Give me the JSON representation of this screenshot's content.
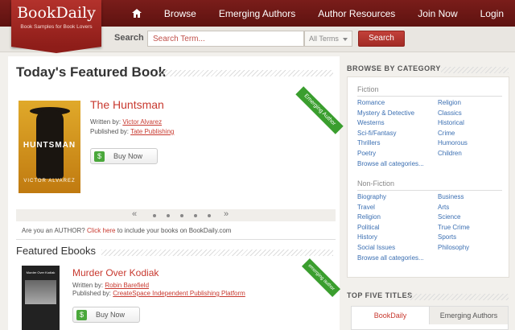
{
  "header": {
    "logo_name": "BookDaily",
    "logo_tagline": "Book Samples for Book Lovers",
    "nav": [
      "Browse",
      "Emerging Authors",
      "Author Resources",
      "Join Now",
      "Login"
    ]
  },
  "search": {
    "label": "Search",
    "placeholder": "Search Term...",
    "filter": "All Terms",
    "button": "Search"
  },
  "featured": {
    "heading": "Today's Featured Book",
    "title": "The Huntsman",
    "cover_title": "HUNTSMAN",
    "cover_author": "VICTOR ALVAREZ",
    "written_by_label": "Written by:",
    "author": "Victor Alvarez",
    "published_by_label": "Published by:",
    "publisher": "Tate Publishing",
    "buy_label": "Buy Now",
    "ribbon": "Emerging Author"
  },
  "author_prompt": {
    "prefix": "Are you an AUTHOR?",
    "link": "Click here",
    "suffix": "to include your books on BookDaily.com"
  },
  "ebooks": {
    "heading": "Featured Ebooks",
    "title": "Murder Over Kodiak",
    "cover_title": "Murder Over Kodiak",
    "written_by_label": "Written by:",
    "author": "Robin Barefield",
    "published_by_label": "Published by:",
    "publisher": "CreateSpace Independent Publishing Platform",
    "buy_label": "Buy Now",
    "ribbon": "emerging author"
  },
  "sidebar": {
    "browse_heading": "BROWSE BY CATEGORY",
    "fiction_label": "Fiction",
    "fiction_left": [
      "Romance",
      "Mystery & Detective",
      "Westerns",
      "Sci-fi/Fantasy",
      "Thrillers",
      "Poetry",
      "Browse all categories..."
    ],
    "fiction_right": [
      "Religion",
      "Classics",
      "Historical",
      "Crime",
      "Humorous",
      "Children"
    ],
    "nonfiction_label": "Non-Fiction",
    "nonfiction_left": [
      "Biography",
      "Travel",
      "Religion",
      "Political",
      "History",
      "Social Issues",
      "Browse all categories..."
    ],
    "nonfiction_right": [
      "Business",
      "Arts",
      "Science",
      "True Crime",
      "Sports",
      "Philosophy"
    ],
    "top_heading": "TOP FIVE TITLES",
    "tabs": [
      "BookDaily",
      "Emerging Authors"
    ]
  }
}
